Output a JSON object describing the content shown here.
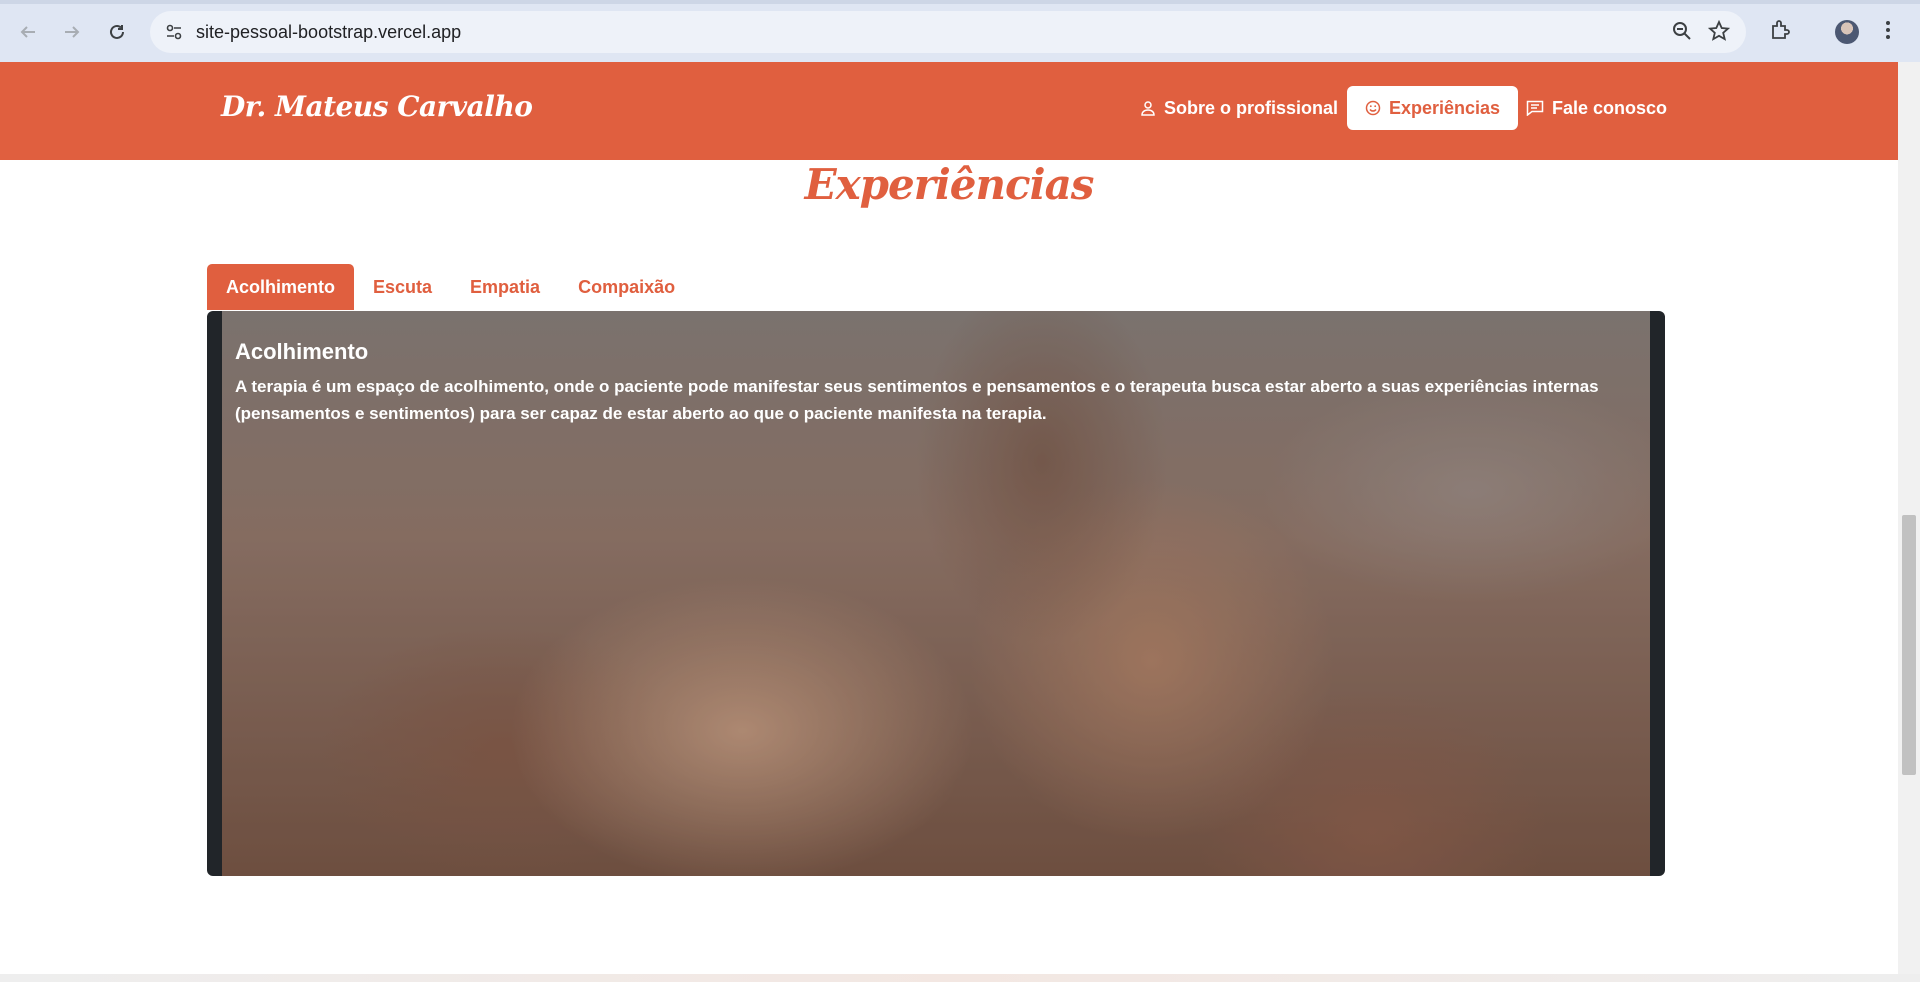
{
  "browser": {
    "url": "site-pessoal-bootstrap.vercel.app"
  },
  "header": {
    "brand": "Dr. Mateus Carvalho",
    "nav": [
      {
        "label": "Sobre o profissional",
        "icon": "person-icon"
      },
      {
        "label": "Experiências",
        "icon": "smile-icon",
        "active": true
      },
      {
        "label": "Fale conosco",
        "icon": "chat-icon"
      }
    ]
  },
  "section": {
    "title": "Experiências"
  },
  "tabs": [
    {
      "label": "Acolhimento",
      "active": true
    },
    {
      "label": "Escuta"
    },
    {
      "label": "Empatia"
    },
    {
      "label": "Compaixão"
    }
  ],
  "panel": {
    "title": "Acolhimento",
    "text": "A terapia é um espaço de acolhimento, onde o paciente pode manifestar seus sentimentos e pensamentos e o terapeuta busca estar aberto a suas experiências internas (pensamentos e sentimentos) para ser capaz de estar aberto ao que o paciente manifesta na terapia.",
    "image": "hands-holding-photo"
  },
  "colors": {
    "accent": "#e05f3f",
    "panel_bg": "#212529"
  }
}
